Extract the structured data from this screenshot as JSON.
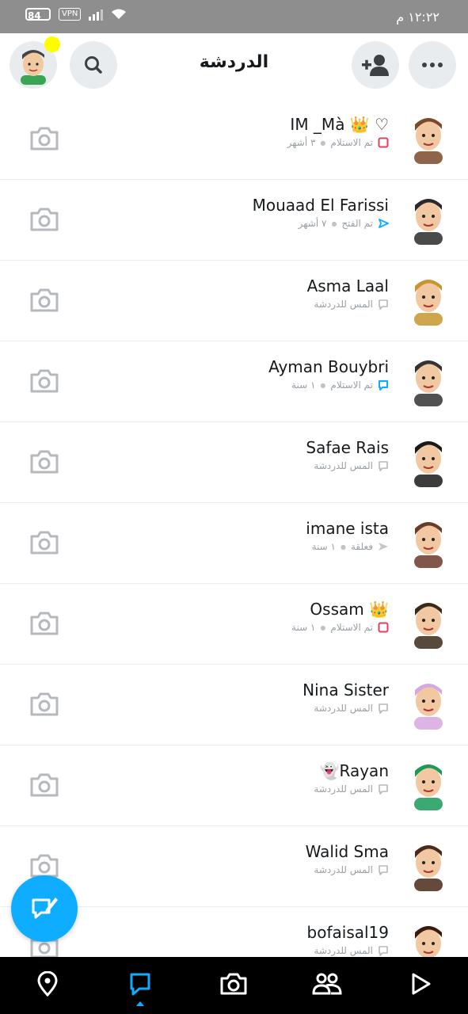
{
  "status_bar": {
    "battery": "84",
    "vpn": "VPN",
    "time": "١٢:٢٢ م"
  },
  "header": {
    "title": "الدردشة"
  },
  "chats": [
    {
      "name": "IM _Mà 👑 ♡",
      "status": "تم الاستلام",
      "time": "٣ أشهر",
      "indicator": "received-red",
      "avatar_color": "#7a4a2a"
    },
    {
      "name": "Mouaad El Farissi",
      "status": "تم الفتح",
      "time": "٧ أشهر",
      "indicator": "opened-blue",
      "avatar_color": "#2a2a2a"
    },
    {
      "name": "Asma Laal",
      "status": "المس للدردشة",
      "time": "",
      "indicator": "chat-gray",
      "avatar_color": "#c8962e"
    },
    {
      "name": "Ayman Bouybri",
      "status": "تم الاستلام",
      "time": "١ سنة",
      "indicator": "received-blue",
      "avatar_color": "#333333"
    },
    {
      "name": "Safae Rais",
      "status": "المس للدردشة",
      "time": "",
      "indicator": "chat-gray",
      "avatar_color": "#1a1a1a"
    },
    {
      "name": "imane ista",
      "status": "فعلقة",
      "time": "١ سنة",
      "indicator": "pending-gray",
      "avatar_color": "#6a3a2a"
    },
    {
      "name": "Ossam 👑",
      "status": "تم الاستلام",
      "time": "١ سنة",
      "indicator": "received-red",
      "avatar_color": "#3a2a1a"
    },
    {
      "name": "Nina Sister",
      "status": "المس للدردشة",
      "time": "",
      "indicator": "chat-gray",
      "avatar_color": "#d6a8e0"
    },
    {
      "name": "👻Rayan",
      "status": "المس للدردشة",
      "time": "",
      "indicator": "chat-gray",
      "avatar_color": "#1a9a5a"
    },
    {
      "name": "Walid Sma",
      "status": "المس للدردشة",
      "time": "",
      "indicator": "chat-gray",
      "avatar_color": "#4a2a1a"
    },
    {
      "name": "bofaisal19",
      "status": "المس للدردشة",
      "time": "",
      "indicator": "chat-gray",
      "avatar_color": "#3a1a0a"
    }
  ],
  "bottom_nav": {
    "items": [
      "map-icon",
      "chat-icon",
      "camera-icon",
      "friends-icon",
      "discover-icon"
    ],
    "active": "chat-icon"
  },
  "colors": {
    "accent": "#0eadff",
    "received_red": "#e0405a",
    "opened_blue": "#0eadff",
    "notif_yellow": "#fffc00"
  }
}
